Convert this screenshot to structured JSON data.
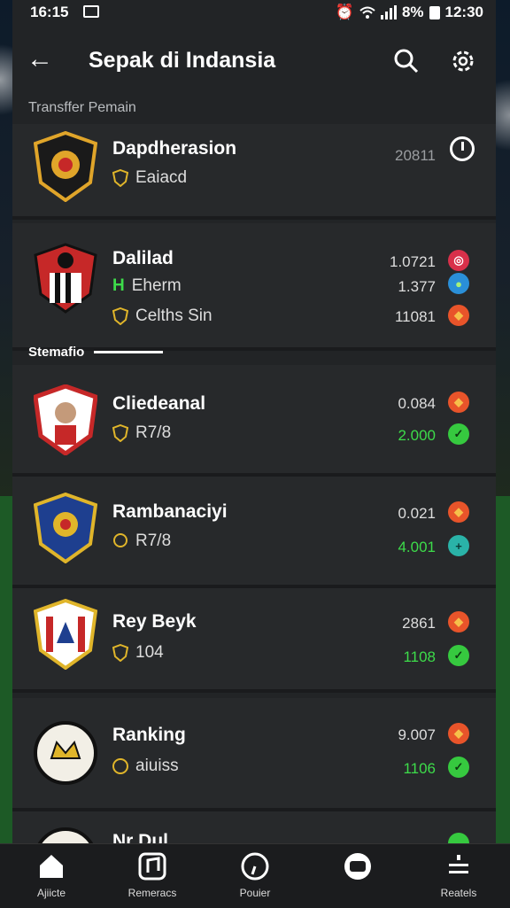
{
  "status_bar": {
    "time": "16:15",
    "battery": "8%",
    "clock": "12:30"
  },
  "header": {
    "title": "Sepak di Indansia"
  },
  "sections": {
    "transfer": "Transffer Pemain",
    "stematic": "Stemafio"
  },
  "rows": [
    {
      "name": "Dapdherasion",
      "sub": "Eaiacd",
      "values": [
        "20811"
      ],
      "action": "clock"
    },
    {
      "name": "Dalilad",
      "subs": [
        "Eherm",
        "Celths Sin"
      ],
      "values": [
        "1.0721",
        "1.377",
        "11081"
      ]
    },
    {
      "name": "Cliedeanal",
      "sub": "R7/8",
      "values": [
        "0.084",
        "2.000"
      ]
    },
    {
      "name": "Rambanaciyi",
      "sub": "R7/8",
      "values": [
        "0.021",
        "4.001"
      ]
    },
    {
      "name": "Rey Beyk",
      "sub": "104",
      "values": [
        "2861",
        "1108"
      ]
    },
    {
      "name": "Ranking",
      "sub": "aiuiss",
      "values": [
        "9.007",
        "1106"
      ]
    },
    {
      "name": "Nr Dul",
      "values": []
    }
  ],
  "nav": [
    {
      "label": "Ajiicte",
      "icon": "home-icon"
    },
    {
      "label": "Remeracs",
      "icon": "music-icon"
    },
    {
      "label": "Pouier",
      "icon": "clock-icon"
    },
    {
      "label": "",
      "icon": "tv-icon"
    },
    {
      "label": "Reatels",
      "icon": "menu-icon"
    }
  ],
  "colors": {
    "panel": "#222426",
    "green_value": "#3ddc4a",
    "orange_badge": "#e8542a"
  }
}
